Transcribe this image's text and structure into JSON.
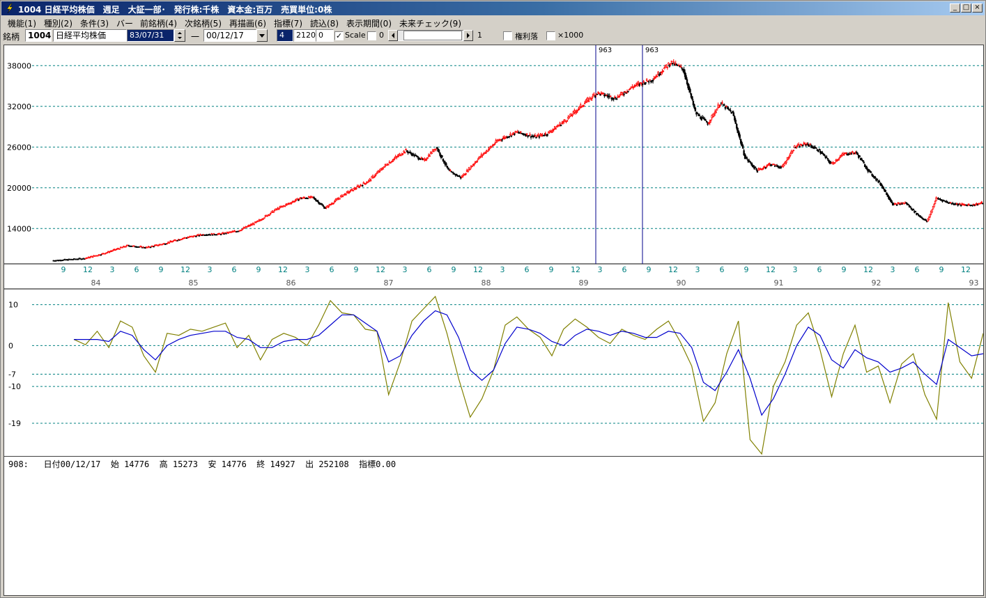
{
  "window": {
    "title": "1004 日経平均株価　週足　大証一部･　発行株:千株　資本金:百万　売買単位:0株",
    "buttons": {
      "minimize": "_",
      "maximize": "□",
      "close": "×"
    }
  },
  "menu": [
    "機能(1)",
    "種別(2)",
    "条件(3)",
    "バー",
    "前銘柄(4)",
    "次銘柄(5)",
    "再描画(6)",
    "指標(7)",
    "読込(8)",
    "表示期間(0)",
    "未来チェック(9)"
  ],
  "toolbar": {
    "stock_label": "銘柄",
    "code": "1004",
    "name": "日経平均株価",
    "from_date": "83/07/31",
    "dash": "一",
    "to_date": "00/12/17",
    "param1": "4",
    "param2": "2120",
    "param3": "0",
    "scale_label": "Scale",
    "scale_value": "0",
    "scroll_value": "1",
    "kenri_label": "権利落",
    "x1000_label": "×1000"
  },
  "icons": {
    "app": "lightning-app-icon",
    "combo": "chevron-down-icon",
    "spin": "spin-arrows-icon",
    "scroll_left": "arrow-left-icon",
    "scroll_right": "arrow-right-icon"
  },
  "colors": {
    "up_candle": "#ff0000",
    "down_candle": "#000000",
    "grid": "#008080",
    "axis_text": "#008080",
    "osc_fast": "#808000",
    "osc_slow": "#0000cc",
    "marker": "#00008b"
  },
  "chart_data": [
    {
      "type": "candlestick",
      "y_ticks": [
        14000,
        20000,
        26000,
        32000,
        38000
      ],
      "ylim": [
        8800,
        41000
      ],
      "month_ticks": [
        "9",
        "12",
        "3",
        "6",
        "9",
        "12",
        "3",
        "6",
        "9",
        "12",
        "3",
        "6",
        "9",
        "12",
        "3",
        "6",
        "9",
        "12",
        "3",
        "6",
        "9",
        "12",
        "3",
        "6",
        "9",
        "12",
        "3",
        "6",
        "9",
        "12",
        "3",
        "6",
        "9",
        "12",
        "3",
        "6",
        "9",
        "12"
      ],
      "year_labels": [
        "84",
        "85",
        "86",
        "87",
        "88",
        "89",
        "90",
        "91",
        "92",
        "93"
      ],
      "markers": [
        "963",
        "963"
      ],
      "price_path": [
        [
          0,
          9300
        ],
        [
          5,
          9600
        ],
        [
          8,
          10300
        ],
        [
          12,
          11500
        ],
        [
          15,
          11200
        ],
        [
          18,
          11800
        ],
        [
          21,
          12600
        ],
        [
          24,
          13100
        ],
        [
          27,
          13200
        ],
        [
          30,
          13700
        ],
        [
          33,
          15000
        ],
        [
          36,
          16800
        ],
        [
          40,
          18500
        ],
        [
          42,
          18600
        ],
        [
          44,
          17000
        ],
        [
          47,
          19000
        ],
        [
          51,
          21000
        ],
        [
          54,
          23500
        ],
        [
          57,
          25500
        ],
        [
          60,
          24000
        ],
        [
          62,
          26000
        ],
        [
          64,
          22500
        ],
        [
          66,
          21500
        ],
        [
          69,
          24500
        ],
        [
          72,
          27000
        ],
        [
          75,
          28200
        ],
        [
          78,
          27500
        ],
        [
          80,
          28000
        ],
        [
          83,
          30000
        ],
        [
          86,
          32500
        ],
        [
          88,
          34000
        ],
        [
          91,
          33200
        ],
        [
          94,
          35000
        ],
        [
          97,
          36000
        ],
        [
          100,
          38500
        ],
        [
          102,
          37500
        ],
        [
          104,
          31000
        ],
        [
          106,
          29500
        ],
        [
          108,
          32500
        ],
        [
          110,
          31000
        ],
        [
          112,
          24500
        ],
        [
          114,
          22500
        ],
        [
          116,
          23500
        ],
        [
          118,
          23000
        ],
        [
          120,
          26000
        ],
        [
          122,
          26500
        ],
        [
          124,
          25500
        ],
        [
          126,
          23500
        ],
        [
          128,
          25000
        ],
        [
          130,
          25200
        ],
        [
          132,
          22500
        ],
        [
          134,
          20500
        ],
        [
          136,
          17500
        ],
        [
          138,
          17800
        ],
        [
          140,
          16000
        ],
        [
          141.5,
          15000
        ],
        [
          143,
          18500
        ],
        [
          145,
          17800
        ],
        [
          147,
          17500
        ],
        [
          149,
          17500
        ],
        [
          150.5,
          17800
        ]
      ]
    },
    {
      "type": "line",
      "y_ticks": [
        10,
        0,
        -7,
        -10,
        -19
      ],
      "ylim": [
        -27,
        13
      ],
      "series": [
        {
          "values": [
            1.5,
            0.2,
            3.5,
            -0.5,
            6.0,
            4.5,
            -2.5,
            -6.5,
            3.0,
            2.5,
            4.0,
            3.5,
            4.5,
            5.5,
            -0.5,
            2.5,
            -3.5,
            1.5,
            3.0,
            2.0,
            0.0,
            5.0,
            11.0,
            8.0,
            7.5,
            4.0,
            3.5,
            -12.0,
            -4.0,
            6.0,
            9.0,
            12.0,
            3.0,
            -8.0,
            -17.5,
            -13.0,
            -6.0,
            5.0,
            7.0,
            4.0,
            2.0,
            -2.5,
            4.0,
            6.5,
            4.5,
            2.0,
            0.5,
            4.0,
            2.5,
            1.5,
            4.0,
            6.0,
            1.0,
            -5.0,
            -18.5,
            -14.0,
            -2.0,
            6.0,
            -23.0,
            -26.5,
            -10.0,
            -4.0,
            5.0,
            8.0,
            -1.0,
            -12.5,
            -2.0,
            5.0,
            -6.5,
            -5.0,
            -14.0,
            -4.5,
            -2.0,
            -12.0,
            -18.0,
            10.5,
            -4.0,
            -8.0,
            3.0
          ]
        },
        {
          "values": [
            1.5,
            1.5,
            1.5,
            1.0,
            3.5,
            2.5,
            -1.0,
            -3.5,
            0.0,
            1.5,
            2.5,
            3.0,
            3.5,
            3.5,
            2.0,
            1.5,
            -0.5,
            -0.5,
            1.0,
            1.5,
            1.5,
            2.5,
            5.0,
            7.5,
            7.5,
            5.5,
            3.5,
            -4.0,
            -2.5,
            2.5,
            6.0,
            8.5,
            7.5,
            2.0,
            -6.0,
            -8.5,
            -6.0,
            0.5,
            4.5,
            4.0,
            3.0,
            1.0,
            0.0,
            2.5,
            4.0,
            3.5,
            2.5,
            3.5,
            3.0,
            2.0,
            2.0,
            3.5,
            3.0,
            -0.5,
            -9.0,
            -11.0,
            -6.5,
            -1.0,
            -8.0,
            -17.0,
            -13.0,
            -7.0,
            0.0,
            4.5,
            2.5,
            -3.5,
            -5.5,
            -1.0,
            -3.0,
            -4.0,
            -6.5,
            -5.5,
            -4.0,
            -7.0,
            -9.5,
            1.5,
            -0.5,
            -2.5,
            -2.0
          ]
        }
      ]
    }
  ],
  "status": {
    "bar_no": "908:",
    "date": "日付00/12/17",
    "open": "始 14776",
    "high": "高 15273",
    "low": "安 14776",
    "close": "終 14927",
    "volume": "出 252108",
    "indicator": "指標0.00"
  }
}
